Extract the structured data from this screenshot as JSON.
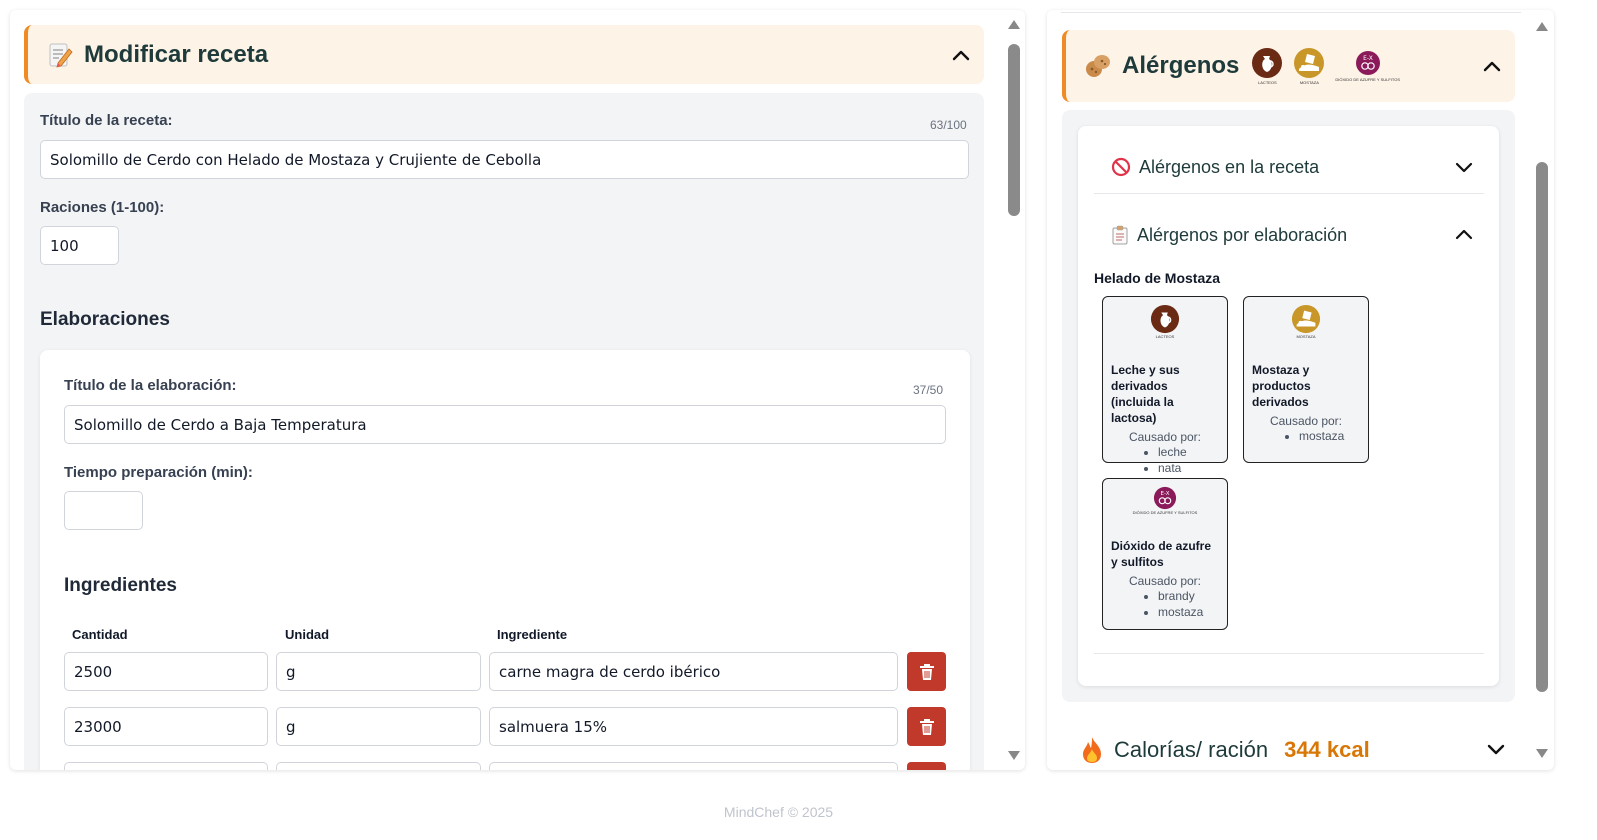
{
  "recipe_panel": {
    "title": "Modificar receta",
    "recipe_title_label": "Título de la receta:",
    "recipe_title_counter": "63/100",
    "recipe_title_value": "Solomillo de Cerdo con Helado de Mostaza y Crujiente de Cebolla",
    "servings_label": "Raciones (1-100):",
    "servings_value": "100",
    "elaborations_heading": "Elaboraciones",
    "elaboration": {
      "title_label": "Título de la elaboración:",
      "title_counter": "37/50",
      "title_value": "Solomillo de Cerdo a Baja Temperatura",
      "prep_time_label": "Tiempo preparación (min):",
      "prep_time_value": "",
      "ingredients_heading": "Ingredientes",
      "columns": {
        "quantity": "Cantidad",
        "unit": "Unidad",
        "ingredient": "Ingrediente"
      },
      "ingredients": [
        {
          "quantity": "2500",
          "unit": "g",
          "ingredient": "carne magra de cerdo ibérico"
        },
        {
          "quantity": "23000",
          "unit": "g",
          "ingredient": "salmuera 15%"
        },
        {
          "quantity": "",
          "unit": "",
          "ingredient": ""
        }
      ]
    }
  },
  "allergens_panel": {
    "title": "Alérgenos",
    "header_badges": [
      {
        "icon": "milk-jug-icon",
        "caption": "LACTEOS",
        "color": "#6b2a13"
      },
      {
        "icon": "mustard-icon",
        "caption": "MOSTAZA",
        "color": "#c9962a"
      },
      {
        "icon": "sulphite-icon",
        "caption": "DIÓXIDO DE AZUFRE Y SULFITOS",
        "color": "#8b1a5a"
      }
    ],
    "in_recipe_label": "Alérgenos en la receta",
    "by_elaboration_label": "Alérgenos por elaboración",
    "elaboration_name": "Helado de Mostaza",
    "caused_by_label": "Causado por:",
    "cards": [
      {
        "icon": "milk-jug-icon",
        "caption": "LACTEOS",
        "name": "Leche y sus derivados (incluida la lactosa)",
        "causes": [
          "leche",
          "nata"
        ]
      },
      {
        "icon": "mustard-icon",
        "caption": "MOSTAZA",
        "name": "Mostaza y productos derivados",
        "causes": [
          "mostaza"
        ]
      },
      {
        "icon": "sulphite-icon",
        "caption": "DIÓXIDO DE AZUFRE Y SULFITOS",
        "name": "Dióxido de azufre y sulfitos",
        "causes": [
          "brandy",
          "mostaza"
        ]
      }
    ],
    "calories_label": "Calorías/ ración",
    "calories_value": "344 kcal"
  },
  "footer": "MindChef © 2025",
  "colors": {
    "accent_orange": "#f08a24",
    "header_bg": "#fdf3e7",
    "delete_red": "#c0392b",
    "calorie_orange": "#d97706"
  }
}
